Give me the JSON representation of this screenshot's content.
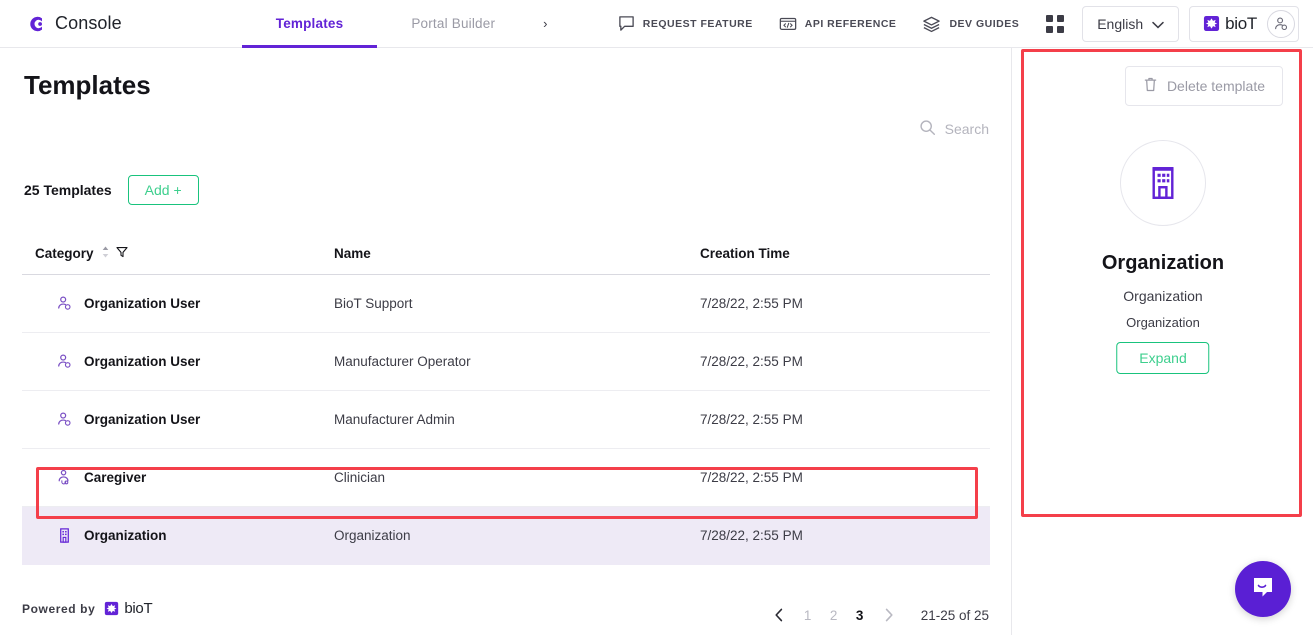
{
  "topnav": {
    "brand": "Console",
    "tabs": [
      {
        "label": "Templates",
        "active": true
      },
      {
        "label": "Portal Builder",
        "active": false
      }
    ],
    "chevron": "›",
    "links": [
      {
        "label": "REQUEST FEATURE",
        "icon": "speech-bubble-icon"
      },
      {
        "label": "API REFERENCE",
        "icon": "code-folder-icon"
      },
      {
        "label": "DEV GUIDES",
        "icon": "books-icon"
      }
    ],
    "apps_icon": "apps-grid-icon",
    "language": {
      "value": "English",
      "caret": "⌄"
    },
    "account": {
      "brand": "bioT",
      "avatar_icon": "user-gear-icon"
    }
  },
  "main": {
    "page_title": "Templates",
    "search": {
      "placeholder": "Search",
      "icon": "search-icon"
    },
    "count_label": "25 Templates",
    "add_label": "Add +",
    "table": {
      "columns": [
        {
          "key": "category",
          "label": "Category",
          "sort_icon": "sort-arrows-icon",
          "filter_icon": "filter-icon"
        },
        {
          "key": "name",
          "label": "Name"
        },
        {
          "key": "time",
          "label": "Creation Time"
        }
      ],
      "rows": [
        {
          "icon": "user-gear-icon",
          "category": "Organization User",
          "name": "BioT Support",
          "time": "7/28/22, 2:55 PM",
          "selected": false
        },
        {
          "icon": "user-gear-icon",
          "category": "Organization User",
          "name": "Manufacturer Operator",
          "time": "7/28/22, 2:55 PM",
          "selected": false
        },
        {
          "icon": "user-gear-icon",
          "category": "Organization User",
          "name": "Manufacturer Admin",
          "time": "7/28/22, 2:55 PM",
          "selected": false
        },
        {
          "icon": "caregiver-icon",
          "category": "Caregiver",
          "name": "Clinician",
          "time": "7/28/22, 2:55 PM",
          "selected": false
        },
        {
          "icon": "building-icon",
          "category": "Organization",
          "name": "Organization",
          "time": "7/28/22, 2:55 PM",
          "selected": true
        }
      ]
    },
    "pagination": {
      "prev_icon": "chevron-left-icon",
      "next_icon": "chevron-right-icon",
      "pages": [
        "1",
        "2",
        "3"
      ],
      "current_page": "3",
      "range": "21-25 of 25"
    },
    "footer": {
      "label": "Powered by",
      "brand": "bioT"
    }
  },
  "panel": {
    "delete_label": "Delete template",
    "delete_icon": "trash-icon",
    "avatar_icon": "building-icon",
    "title": "Organization",
    "subtitle1": "Organization",
    "subtitle2": "Organization",
    "expand_label": "Expand"
  },
  "chat": {
    "icon": "chat-smile-icon"
  },
  "highlights": {
    "row_color": "#f43f4a",
    "panel_color": "#f43f4a"
  },
  "colors": {
    "accent_purple": "#6223d6",
    "accent_green": "#19c37d",
    "selected_row_bg": "#eeeaf6",
    "chat_bg": "#5a1fd4"
  }
}
